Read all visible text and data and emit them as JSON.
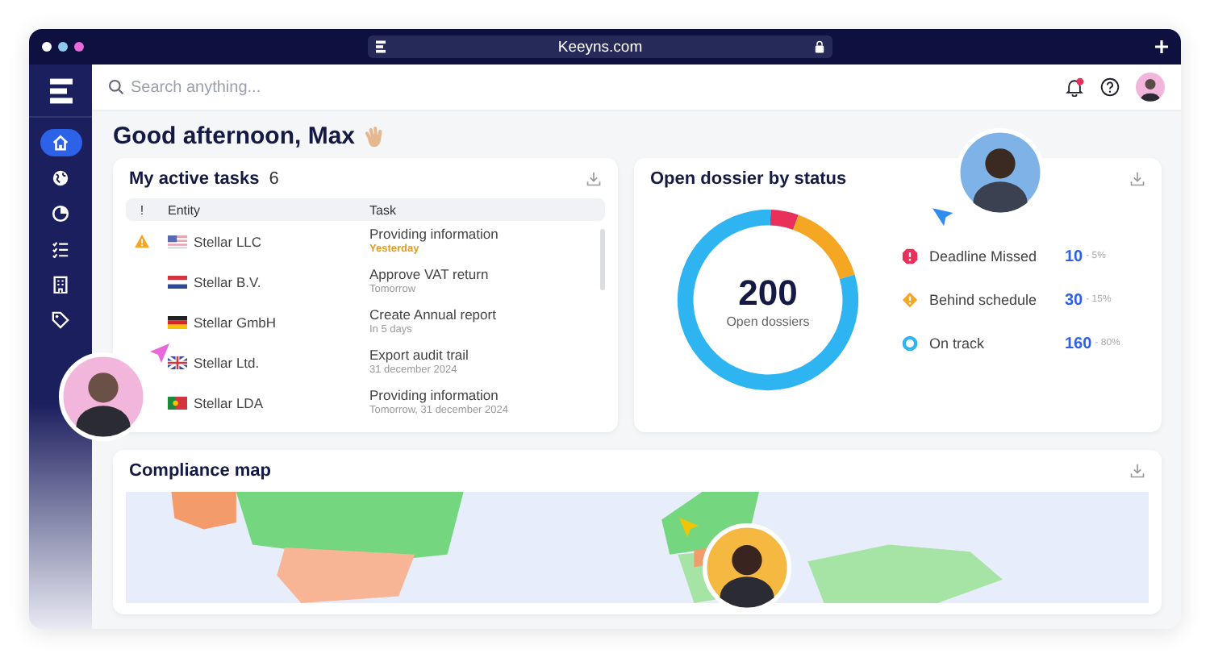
{
  "browser": {
    "url": "Keeyns.com"
  },
  "sidebar": {
    "items": [
      {
        "selected": true
      },
      {
        "selected": false
      },
      {
        "selected": false
      },
      {
        "selected": false
      },
      {
        "selected": false
      },
      {
        "selected": false
      }
    ]
  },
  "search": {
    "placeholder": "Search anything..."
  },
  "greeting": "Good afternoon, Max",
  "tasks": {
    "title": "My active tasks",
    "count": "6",
    "columns": [
      "!",
      "Entity",
      "Task"
    ],
    "rows": [
      {
        "warning": true,
        "kind": "us",
        "entity": "Stellar LLC",
        "task": "Providing information",
        "due": "Yesterday",
        "overdue": true
      },
      {
        "warning": false,
        "kind": "nl",
        "entity": "Stellar B.V.",
        "task": "Approve VAT return",
        "due": "Tomorrow",
        "overdue": false
      },
      {
        "warning": false,
        "kind": "de",
        "entity": "Stellar GmbH",
        "task": "Create Annual report",
        "due": "In 5 days",
        "overdue": false
      },
      {
        "warning": false,
        "kind": "gb",
        "entity": "Stellar Ltd.",
        "task": "Export audit trail",
        "due": "31 december 2024",
        "overdue": false
      },
      {
        "warning": false,
        "kind": "pt",
        "entity": "Stellar LDA",
        "task": "Providing information",
        "due": "Tomorrow, 31 december 2024",
        "overdue": false
      }
    ]
  },
  "dossiers": {
    "title": "Open dossier by status",
    "total": "200",
    "chart_data": {
      "type": "donut",
      "categories": [
        "Deadline Missed",
        "Behind schedule",
        "On track"
      ],
      "series": [
        {
          "name": "Open dossiers",
          "values": [
            5,
            15,
            80
          ]
        }
      ]
    },
    "legend": [
      {
        "kind": "missed",
        "color": "#e8305a",
        "count": "10",
        "percent": "- 5%"
      },
      {
        "kind": "behind",
        "color": "#f5a623",
        "count": "30",
        "percent": "- 15%"
      },
      {
        "kind": "ontrack",
        "color": "#2fb4f2",
        "count": "160",
        "percent": "- 80%"
      }
    ]
  },
  "map": {
    "title": "Compliance map"
  }
}
